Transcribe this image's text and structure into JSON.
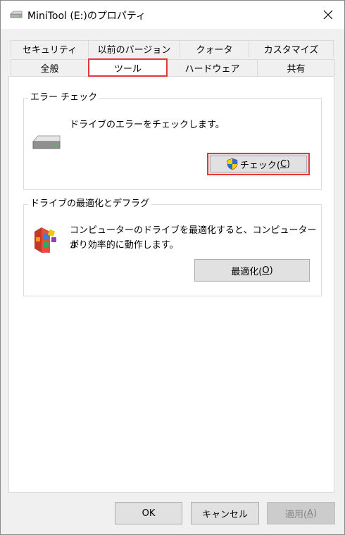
{
  "window": {
    "title": "MiniTool (E:)のプロパティ"
  },
  "tabs_top": [
    "セキュリティ",
    "以前のバージョン",
    "クォータ",
    "カスタマイズ"
  ],
  "tabs_bottom": [
    "全般",
    "ツール",
    "ハードウェア",
    "共有"
  ],
  "active_tab": "ツール",
  "error_check": {
    "title": "エラー チェック",
    "description": "ドライブのエラーをチェックします。",
    "button_label": "チェック(",
    "button_mnemonic": "C",
    "button_suffix": ")"
  },
  "optimize": {
    "title": "ドライブの最適化とデフラグ",
    "description_line1": "コンピューターのドライブを最適化すると、コンピューターが",
    "description_line2": "より効率的に動作します。",
    "button_label": "最適化(",
    "button_mnemonic": "O",
    "button_suffix": ")"
  },
  "footer": {
    "ok": "OK",
    "cancel": "キャンセル",
    "apply_label": "適用(",
    "apply_mnemonic": "A",
    "apply_suffix": ")"
  },
  "colors": {
    "highlight": "#e53935",
    "panel": "#ffffff",
    "window": "#f0f0f0"
  }
}
